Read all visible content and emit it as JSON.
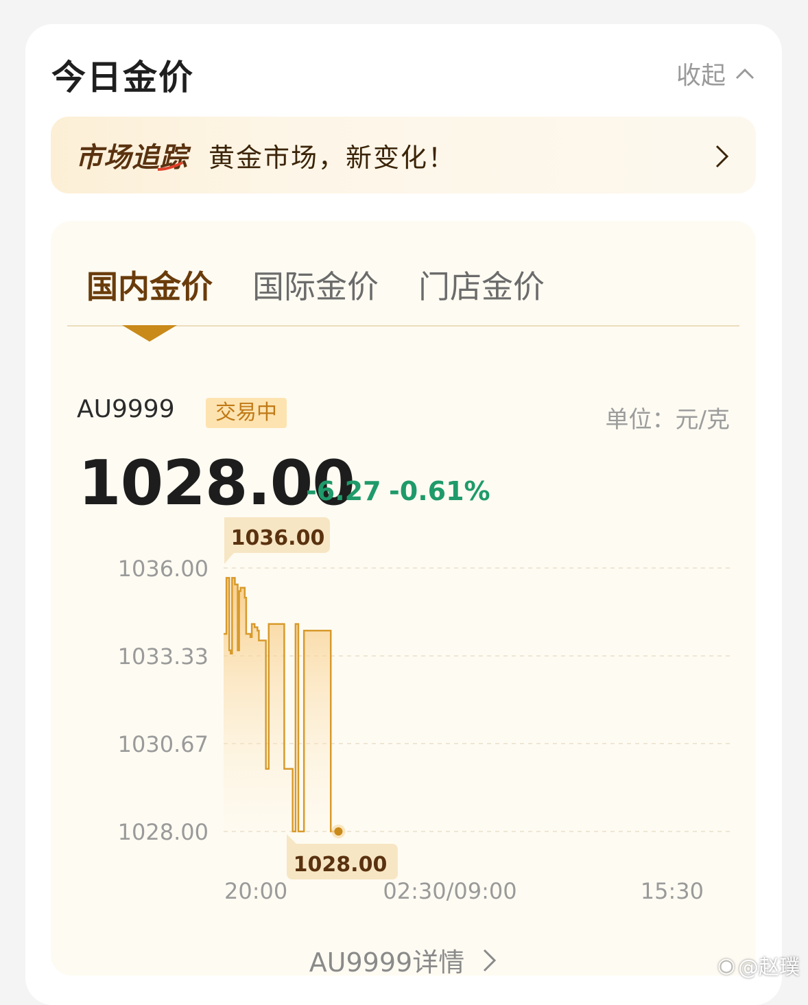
{
  "header": {
    "title": "今日金价",
    "collapse_label": "收起"
  },
  "banner": {
    "logo_text": "市场追踪",
    "text": "黄金市场，新变化！"
  },
  "tabs": [
    {
      "label": "国内金价",
      "active": true
    },
    {
      "label": "国际金价",
      "active": false
    },
    {
      "label": "门店金价",
      "active": false
    }
  ],
  "quote": {
    "symbol": "AU9999",
    "status": "交易中",
    "unit": "单位：元/克",
    "price": "1028.00",
    "change": "-6.27",
    "change_pct": "-0.61%"
  },
  "colors": {
    "accent": "#c98a1a",
    "down": "#1f9a6a",
    "title": "#6a3c0b"
  },
  "chart_data": {
    "type": "area",
    "y_ticks": [
      "1036.00",
      "1033.33",
      "1030.67",
      "1028.00"
    ],
    "ylim": [
      1028.0,
      1036.0
    ],
    "x_ticks": [
      "20:00",
      "02:30/09:00",
      "15:30"
    ],
    "max_label": "1036.00",
    "min_label": "1028.00",
    "series": [
      {
        "t": [
          0,
          2,
          4,
          6,
          8,
          10,
          12,
          14,
          16,
          18,
          20,
          22,
          24,
          26,
          28,
          30,
          32,
          34,
          36,
          38,
          40,
          42,
          44,
          46,
          48,
          50,
          52,
          54,
          56,
          58,
          60,
          62,
          64,
          66,
          68,
          70,
          72,
          74,
          76,
          78,
          80,
          82,
          84,
          86,
          88,
          90,
          92,
          94,
          96,
          98,
          100,
          102,
          104,
          106,
          108,
          110,
          112,
          114,
          116,
          118,
          120,
          122,
          124,
          126,
          128,
          130,
          132,
          134,
          136,
          138,
          140,
          142,
          144,
          146,
          148,
          150,
          152,
          154,
          156,
          158
        ],
        "values": [
          1034.0,
          1034.0,
          1035.7,
          1035.7,
          1033.5,
          1033.4,
          1035.7,
          1035.7,
          1035.5,
          1035.5,
          1033.5,
          1035.3,
          1035.4,
          1035.4,
          1035.4,
          1035.1,
          1034.0,
          1034.0,
          1034.0,
          1033.9,
          1034.3,
          1034.3,
          1034.2,
          1034.2,
          1034.1,
          1033.8,
          1033.8,
          1033.8,
          1033.8,
          1033.8,
          1029.9,
          1029.9,
          1034.3,
          1034.3,
          1034.3,
          1034.3,
          1034.3,
          1034.3,
          1034.3,
          1034.3,
          1034.3,
          1034.3,
          1034.3,
          1029.9,
          1029.9,
          1029.9,
          1029.9,
          1029.9,
          1029.9,
          1028.0,
          1028.0,
          1034.3,
          1034.3,
          1028.0,
          1028.0,
          1028.0,
          1028.0,
          1034.1,
          1034.1,
          1034.1,
          1034.1,
          1034.1,
          1034.1,
          1034.1,
          1034.1,
          1034.1,
          1034.1,
          1034.1,
          1034.1,
          1034.1,
          1034.1,
          1034.1,
          1034.1,
          1034.1,
          1034.1,
          1034.1,
          1028.0,
          1028.0,
          1028.0,
          1028.0
        ]
      }
    ],
    "grid": true
  },
  "footer": {
    "detail_link": "AU9999详情"
  },
  "watermark": "@赵璞"
}
